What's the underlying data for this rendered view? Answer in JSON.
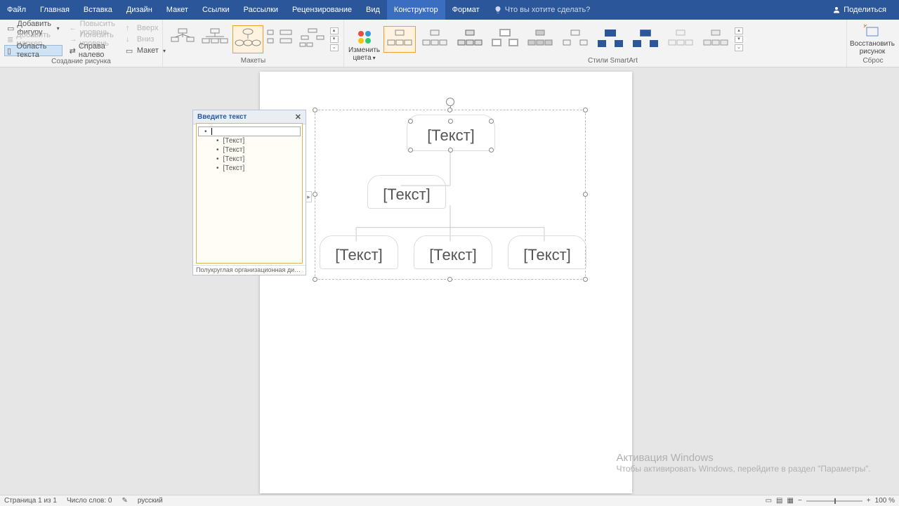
{
  "tabs": {
    "file": "Файл",
    "home": "Главная",
    "insert": "Вставка",
    "design": "Дизайн",
    "layout": "Макет",
    "references": "Ссылки",
    "mailings": "Рассылки",
    "review": "Рецензирование",
    "view": "Вид",
    "constructor": "Конструктор",
    "format": "Формат",
    "tellme": "Что вы хотите сделать?",
    "share": "Поделиться"
  },
  "ribbon": {
    "create": {
      "add_shape": "Добавить фигуру",
      "add_bullet": "Добавить маркер",
      "text_pane": "Область текста",
      "promote": "Повысить уровень",
      "demote": "Понизить уровень",
      "rtl": "Справа налево",
      "up": "Вверх",
      "down": "Вниз",
      "layout_btn": "Макет",
      "label": "Создание рисунка"
    },
    "layouts_label": "Макеты",
    "colors": {
      "line1": "Изменить",
      "line2": "цвета"
    },
    "styles_label": "Стили SmartArt",
    "reset": {
      "line1": "Восстановить",
      "line2": "рисунок",
      "label": "Сброс"
    }
  },
  "text_pane": {
    "title": "Введите текст",
    "items": [
      "[Текст]",
      "[Текст]",
      "[Текст]",
      "[Текст]"
    ],
    "footer": "Полукруглая организационная диагр..."
  },
  "smartart": {
    "placeholder": "[Текст]"
  },
  "watermark": {
    "title": "Активация Windows",
    "sub": "Чтобы активировать Windows, перейдите в раздел \"Параметры\"."
  },
  "status": {
    "page": "Страница 1 из 1",
    "words": "Число слов: 0",
    "lang": "русский",
    "zoom": "100 %"
  }
}
